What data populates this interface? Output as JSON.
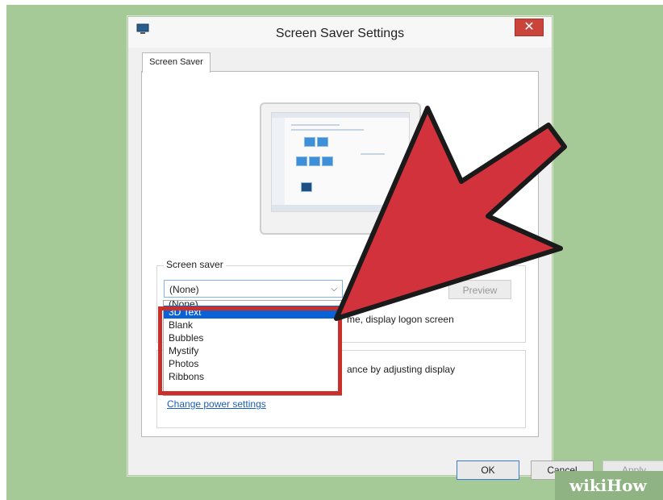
{
  "window": {
    "title": "Screen Saver Settings",
    "close_label": "✕"
  },
  "tabs": [
    {
      "label": "Screen Saver"
    }
  ],
  "screen_saver": {
    "group_label": "Screen saver",
    "selected": "(None)",
    "options": [
      "(None)",
      "3D Text",
      "Blank",
      "Bubbles",
      "Mystify",
      "Photos",
      "Ribbons"
    ],
    "highlighted_option": "3D Text",
    "preview_label": "Preview",
    "logon_text": "me, display logon screen"
  },
  "power": {
    "text": "ance by adjusting display",
    "link": "Change power settings"
  },
  "buttons": {
    "ok": "OK",
    "cancel": "Cancel",
    "apply": "Apply"
  },
  "watermark": {
    "brand": "wikiHow"
  },
  "colors": {
    "arrow": "#d2323c",
    "highlight_box": "#c9302c",
    "background": "#a6c998"
  }
}
